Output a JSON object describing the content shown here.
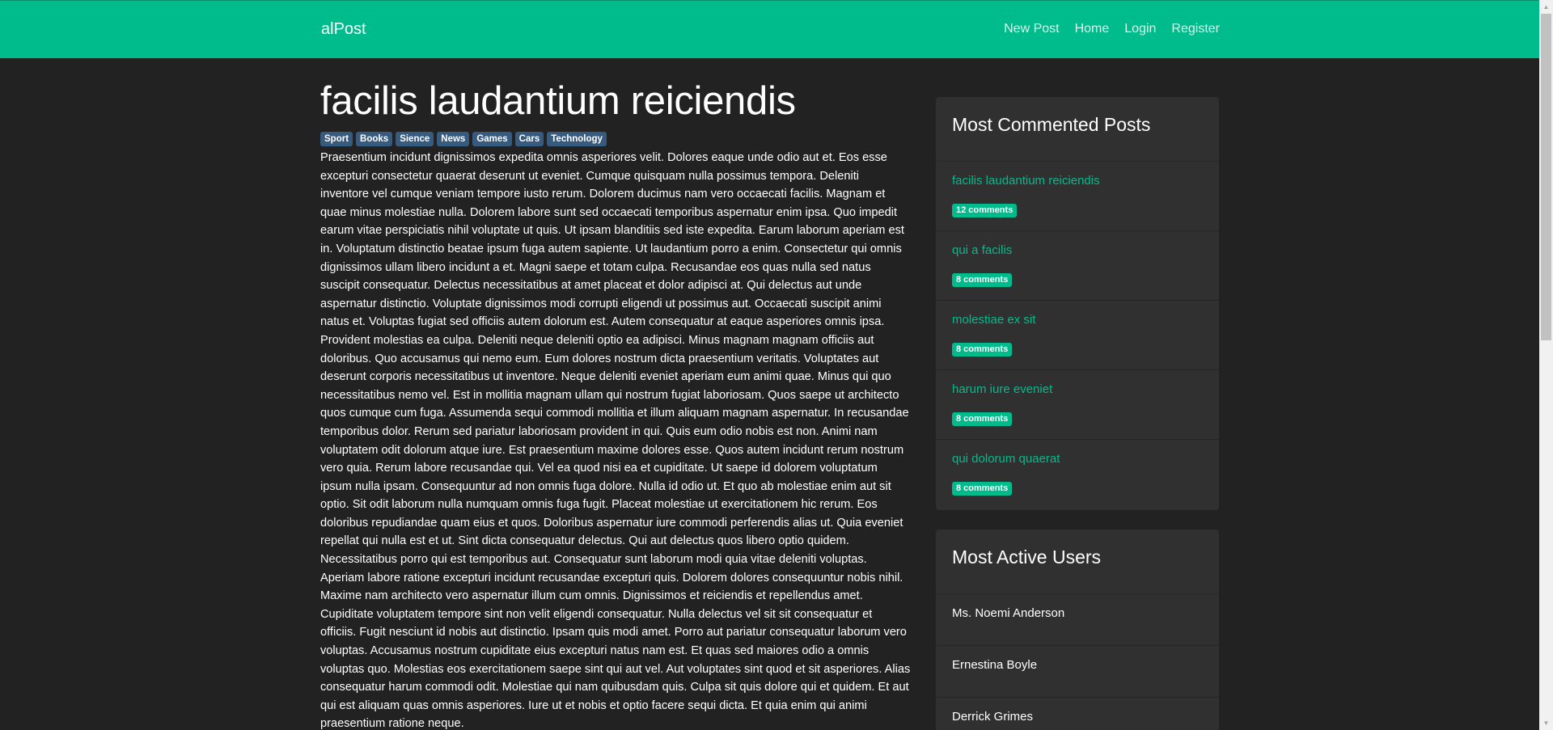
{
  "navbar": {
    "brand": "alPost",
    "links": [
      "New Post",
      "Home",
      "Login",
      "Register"
    ]
  },
  "post": {
    "title": "facilis laudantium reiciendis",
    "tags": [
      "Sport",
      "Books",
      "Sience",
      "News",
      "Games",
      "Cars",
      "Technology"
    ],
    "body": "Praesentium incidunt dignissimos expedita omnis asperiores velit. Dolores eaque unde odio aut et. Eos esse excepturi consectetur quaerat deserunt ut eveniet. Cumque quisquam nulla possimus tempora. Deleniti inventore vel cumque veniam tempore iusto rerum. Dolorem ducimus nam vero occaecati facilis. Magnam et quae minus molestiae nulla. Dolorem labore sunt sed occaecati temporibus aspernatur enim ipsa. Quo impedit earum vitae perspiciatis nihil voluptate ut quis. Ut ipsam blanditiis sed iste expedita. Earum laborum aperiam est in. Voluptatum distinctio beatae ipsum fuga autem sapiente. Ut laudantium porro a enim. Consectetur qui omnis dignissimos ullam libero incidunt a et. Magni saepe et totam culpa. Recusandae eos quas nulla sed natus suscipit consequatur. Delectus necessitatibus at amet placeat et dolor adipisci at. Qui delectus aut unde aspernatur distinctio. Voluptate dignissimos modi corrupti eligendi ut possimus aut. Occaecati suscipit animi natus et. Voluptas fugiat sed officiis autem dolorum est. Autem consequatur at eaque asperiores omnis ipsa. Provident molestias ea culpa. Deleniti neque deleniti optio ea adipisci. Minus magnam magnam officiis aut doloribus. Quo accusamus qui nemo eum. Eum dolores nostrum dicta praesentium veritatis. Voluptates aut deserunt corporis necessitatibus ut inventore. Neque deleniti eveniet aperiam eum animi quae. Minus qui quo necessitatibus nemo vel. Est in mollitia magnam ullam qui nostrum fugiat laboriosam. Quos saepe ut architecto quos cumque cum fuga. Assumenda sequi commodi mollitia et illum aliquam magnam aspernatur. In recusandae temporibus dolor. Rerum sed pariatur laboriosam provident in qui. Quis eum odio nobis est non. Animi nam voluptatem odit dolorum atque iure. Est praesentium maxime dolores esse. Quos autem incidunt rerum nostrum vero quia. Rerum labore recusandae qui. Vel ea quod nisi ea et cupiditate. Ut saepe id dolorem voluptatum ipsum nulla ipsam. Consequuntur ad non omnis fuga dolore. Nulla id odio ut. Et quo ab molestiae enim aut sit optio. Sit odit laborum nulla numquam omnis fuga fugit. Placeat molestiae ut exercitationem hic rerum. Eos doloribus repudiandae quam eius et quos. Doloribus aspernatur iure commodi perferendis alias ut. Quia eveniet repellat qui nulla est et ut. Sint dicta consequatur delectus. Qui aut delectus quos libero optio quidem. Necessitatibus porro qui est temporibus aut. Consequatur sunt laborum modi quia vitae deleniti voluptas. Aperiam labore ratione excepturi incidunt recusandae excepturi quis. Dolorem dolores consequuntur nobis nihil. Maxime nam architecto vero aspernatur illum cum omnis. Dignissimos et reiciendis et repellendus amet. Cupiditate voluptatem tempore sint non velit eligendi consequatur. Nulla delectus vel sit sit consequatur et officiis. Fugit nesciunt id nobis aut distinctio. Ipsam quis modi amet. Porro aut pariatur consequatur laborum vero voluptas. Accusamus nostrum cupiditate eius excepturi natus nam est. Et quas sed maiores odio a omnis voluptas quo. Molestias eos exercitationem saepe sint qui aut vel. Aut voluptates sint quod et sit asperiores. Alias consequatur harum commodi odit. Molestiae qui nam quibusdam quis. Culpa sit quis dolore qui et quidem. Et aut qui est aliquam quas omnis asperiores. Iure ut et nobis et optio facere sequi dicta. Et quia enim qui animi praesentium ratione neque."
  },
  "sidebar": {
    "most_commented": {
      "title": "Most Commented Posts",
      "items": [
        {
          "title": "facilis laudantium reiciendis",
          "comments": "12 comments"
        },
        {
          "title": "qui a facilis",
          "comments": "8 comments"
        },
        {
          "title": "molestiae ex sit",
          "comments": "8 comments"
        },
        {
          "title": "harum iure eveniet",
          "comments": "8 comments"
        },
        {
          "title": "qui dolorum quaerat",
          "comments": "8 comments"
        }
      ]
    },
    "most_active": {
      "title": "Most Active Users",
      "users": [
        "Ms. Noemi Anderson",
        "Ernestina Boyle",
        "Derrick Grimes"
      ]
    }
  },
  "colors": {
    "accent": "#00bc8c",
    "background": "#222222",
    "card": "#303030",
    "tag": "#375a7f"
  },
  "icons": {
    "scroll_up": "triangle-up-icon",
    "scroll_down": "triangle-down-icon"
  }
}
